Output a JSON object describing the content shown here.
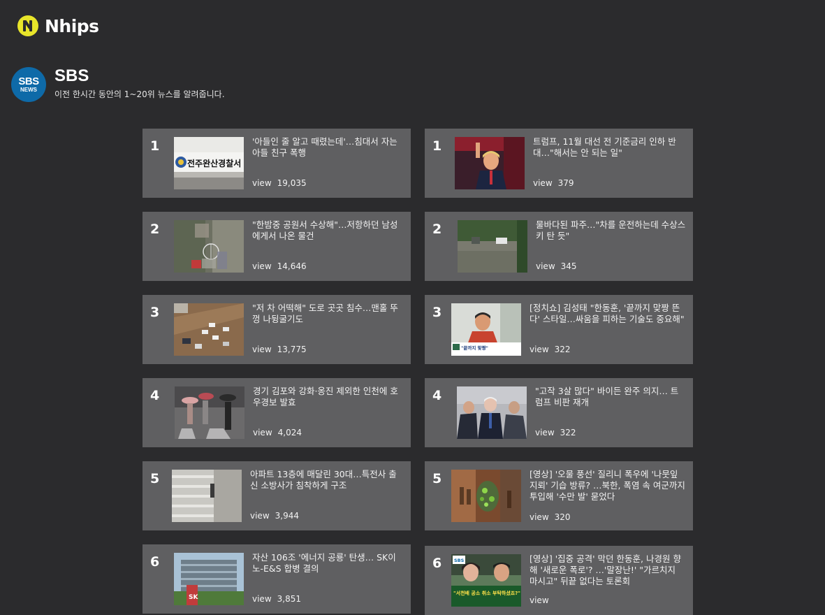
{
  "brand": {
    "name": "Nhips",
    "logo_icon": "nhips-logo-icon",
    "accent": "#e8e52a"
  },
  "source": {
    "logo_line1": "SBS",
    "logo_line2": "NEWS",
    "title": "SBS",
    "description": "이전 한시간 동안의 1~20위 뉴스를 알려줍니다.",
    "logo_color": "#0e6aa8"
  },
  "view_label": "view",
  "left_list": [
    {
      "rank": "1",
      "title": "'아들인 줄 알고 때렸는데'…침대서 자는 아들 친구 폭행",
      "views": "19,035"
    },
    {
      "rank": "2",
      "title": "\"한밤중 공원서 수상해\"…저항하던 남성에게서 나온 물건",
      "views": "14,646"
    },
    {
      "rank": "3",
      "title": "\"저 차 어떡해\" 도로 곳곳 침수…맨홀 뚜껑 나뒹굴기도",
      "views": "13,775"
    },
    {
      "rank": "4",
      "title": "경기 김포와 강화·옹진 제외한 인천에 호우경보 발효",
      "views": "4,024"
    },
    {
      "rank": "5",
      "title": "아파트 13층에 매달린 30대…특전사 출신 소방사가 침착하게 구조",
      "views": "3,944"
    },
    {
      "rank": "6",
      "title": "자산 106조 '에너지 공룡' 탄생… SK이노-E&S 합병 결의",
      "views": "3,851"
    }
  ],
  "right_list": [
    {
      "rank": "1",
      "title": "트럼프, 11월 대선 전 기준금리 인하 반대…\"해서는 안 되는 일\"",
      "views": "379"
    },
    {
      "rank": "2",
      "title": "물바다된 파주…\"차를 운전하는데 수상스키 탄 듯\"",
      "views": "345"
    },
    {
      "rank": "3",
      "title": "[정치쇼] 김성태 \"한동훈, '끝까지 맞짱 뜬다' 스타일…싸움을 피하는 기술도 중요해\"",
      "views": "322"
    },
    {
      "rank": "4",
      "title": "\"고작 3살 많다\" 바이든 완주 의지… 트럼프 비판 재개",
      "views": "322"
    },
    {
      "rank": "5",
      "title": "[영상] '오물 풍선' 질리니 폭우에 '나뭇잎 지뢰' 기습 방류? …북한, 폭염 속 여군까지 투입해 '수만 발' 묻었다",
      "views": "320"
    },
    {
      "rank": "6",
      "title": "[영상] '집중 공격' 막던 한동훈, 나경원 향해 '새로운 폭로'? …'말장난!' \"가르치지 마시고\" 뒤끝 없다는 토론회",
      "views": ""
    }
  ],
  "thumb_texts": {
    "police_sign": "전주완산경찰서",
    "r3_caption": "\"끝까지 맞짱\"",
    "r6_logo": "SBS",
    "r6_caption": "\"서천배 공소 취소 부탁하셨죠?\"",
    "sk_logo": "SK"
  }
}
